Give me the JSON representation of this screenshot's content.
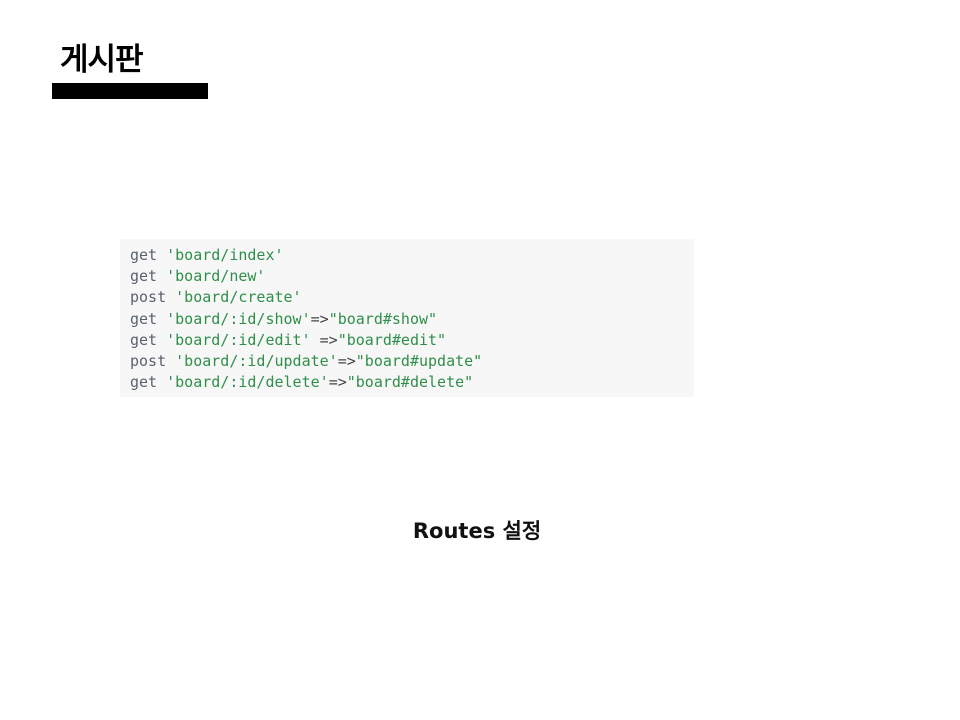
{
  "slide": {
    "title": "게시판",
    "caption": "Routes 설정"
  },
  "code": {
    "lines": [
      {
        "keyword": "get",
        "path": "'board/index'",
        "arrow": "",
        "target": ""
      },
      {
        "keyword": "get",
        "path": "'board/new'",
        "arrow": "",
        "target": ""
      },
      {
        "keyword": "post",
        "path": "'board/create'",
        "arrow": "",
        "target": ""
      },
      {
        "keyword": "get",
        "path": "'board/:id/show'",
        "arrow": "=>",
        "target": "\"board#show\""
      },
      {
        "keyword": "get",
        "path": "'board/:id/edit'",
        "arrow": " =>",
        "target": "\"board#edit\""
      },
      {
        "keyword": "post",
        "path": "'board/:id/update'",
        "arrow": "=>",
        "target": "\"board#update\""
      },
      {
        "keyword": "get",
        "path": "'board/:id/delete'",
        "arrow": "=>",
        "target": "\"board#delete\""
      }
    ]
  },
  "colors": {
    "code_background": "#f7f7f7",
    "string": "#2f8f4a",
    "keyword": "#5a6270",
    "title_bar": "#000000"
  }
}
